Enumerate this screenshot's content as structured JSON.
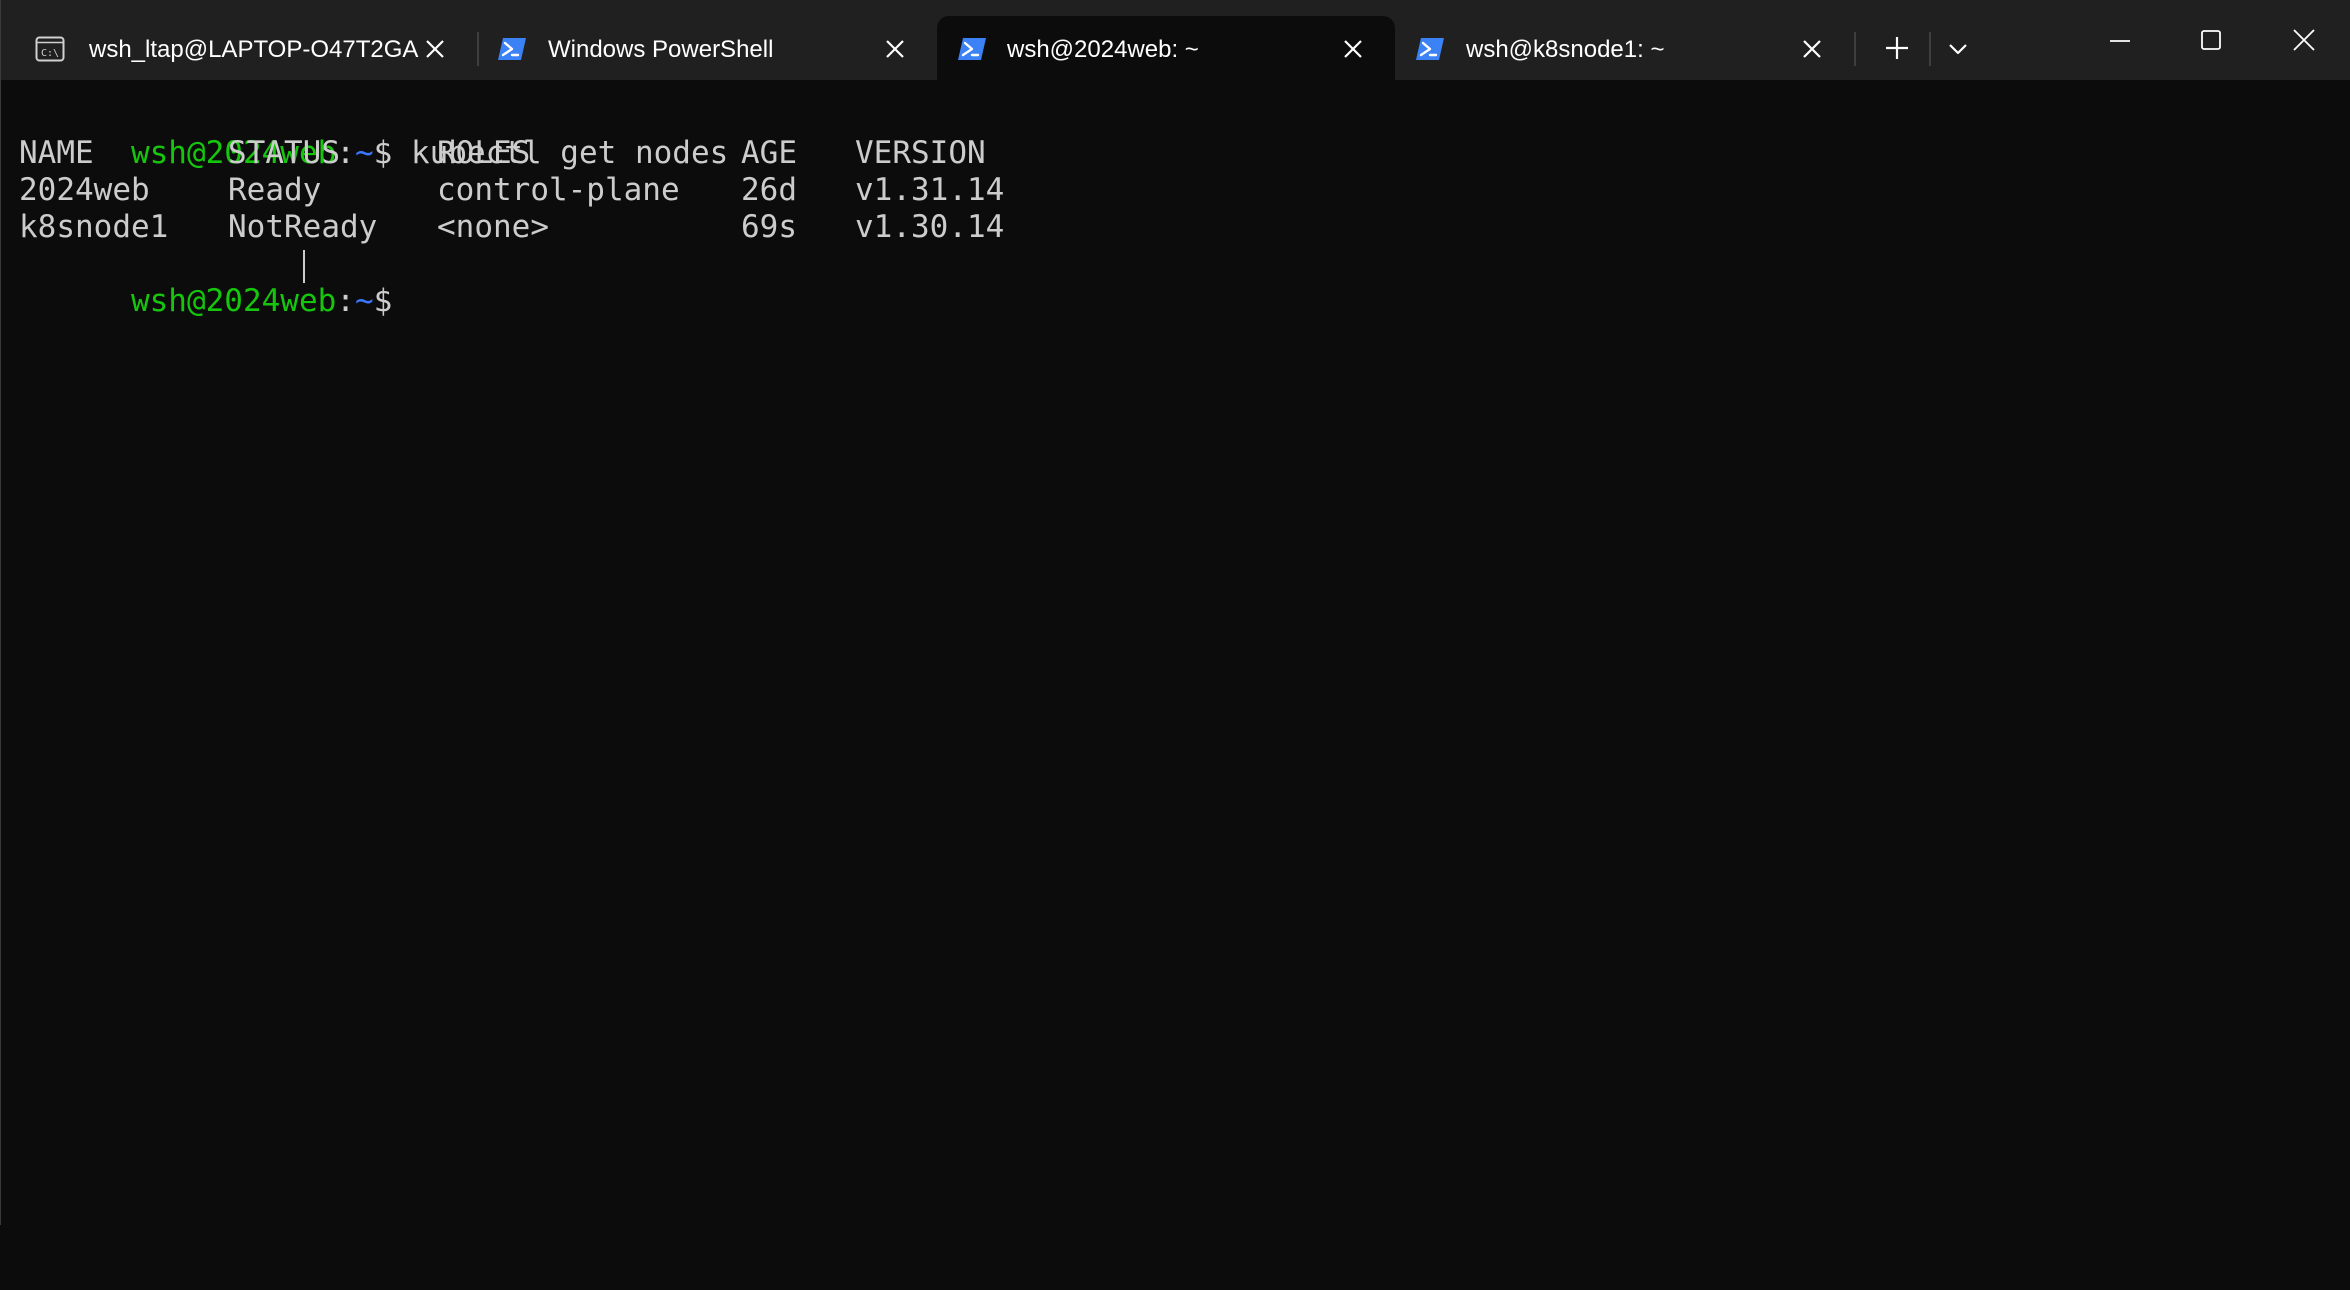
{
  "tabs": [
    {
      "title": "wsh_ltap@LAPTOP-O47T2GA",
      "icon": "cmd-icon",
      "active": false
    },
    {
      "title": "Windows PowerShell",
      "icon": "powershell-icon",
      "active": false
    },
    {
      "title": "wsh@2024web: ~",
      "icon": "powershell-icon",
      "active": true
    },
    {
      "title": "wsh@k8snode1: ~",
      "icon": "powershell-icon",
      "active": false
    }
  ],
  "toolbar": {
    "new_tab_icon": "plus-icon",
    "dropdown_icon": "chevron-down-icon"
  },
  "window_controls": {
    "minimize_icon": "minimize-icon",
    "maximize_icon": "maximize-icon",
    "close_icon": "close-icon"
  },
  "terminal": {
    "prompt": {
      "user_host": "wsh@2024web",
      "colon": ":",
      "path": "~",
      "symbol": "$"
    },
    "command": "kubectl get nodes",
    "table": {
      "headers": [
        "NAME",
        "STATUS",
        "ROLES",
        "AGE",
        "VERSION"
      ],
      "rows": [
        [
          "2024web",
          "Ready",
          "control-plane",
          "26d",
          "v1.31.14"
        ],
        [
          "k8snode1",
          "NotReady",
          "<none>",
          "69s",
          "v1.30.14"
        ]
      ]
    }
  },
  "colors": {
    "background": "#0c0c0c",
    "tabbar": "#202020",
    "text": "#cccccc",
    "prompt_user": "#16c60c",
    "prompt_path": "#3b78ff",
    "powershell_icon": "#3b82f6"
  }
}
